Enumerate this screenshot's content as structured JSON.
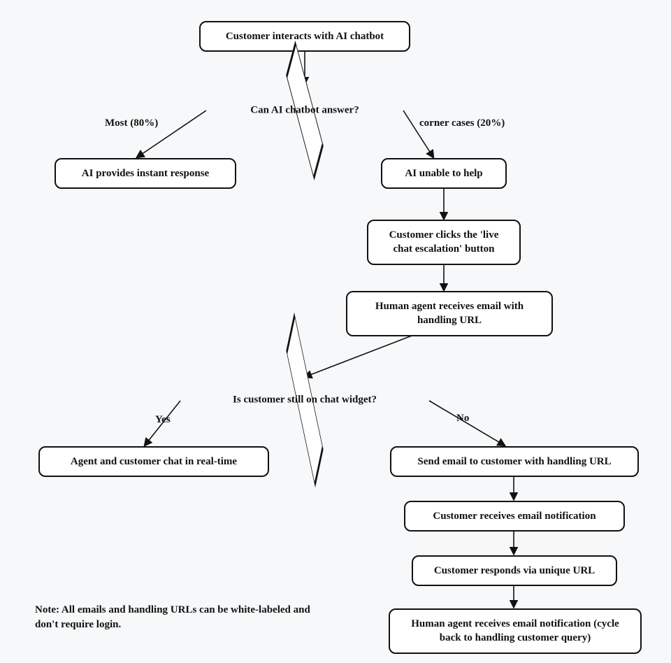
{
  "nodes": {
    "start": "Customer interacts with AI chatbot",
    "decision1": "Can AI chatbot answer?",
    "instant": "AI provides instant response",
    "unable": "AI unable to help",
    "escalate": "Customer clicks the 'live chat escalation' button",
    "agent_email": "Human agent receives email with handling URL",
    "decision2": "Is customer still on chat widget?",
    "realtime": "Agent and customer chat in real-time",
    "send_email": "Send email to customer with handling URL",
    "cust_notif": "Customer receives email notification",
    "cust_resp": "Customer responds via unique URL",
    "agent_notif": "Human agent receives email notification (cycle back to handling customer query)"
  },
  "edges": {
    "most": "Most (80%)",
    "corner": "corner cases (20%)",
    "yes": "Yes",
    "no": "No"
  },
  "note": "Note: All emails and handling URLs can be white-labeled and don't require login."
}
